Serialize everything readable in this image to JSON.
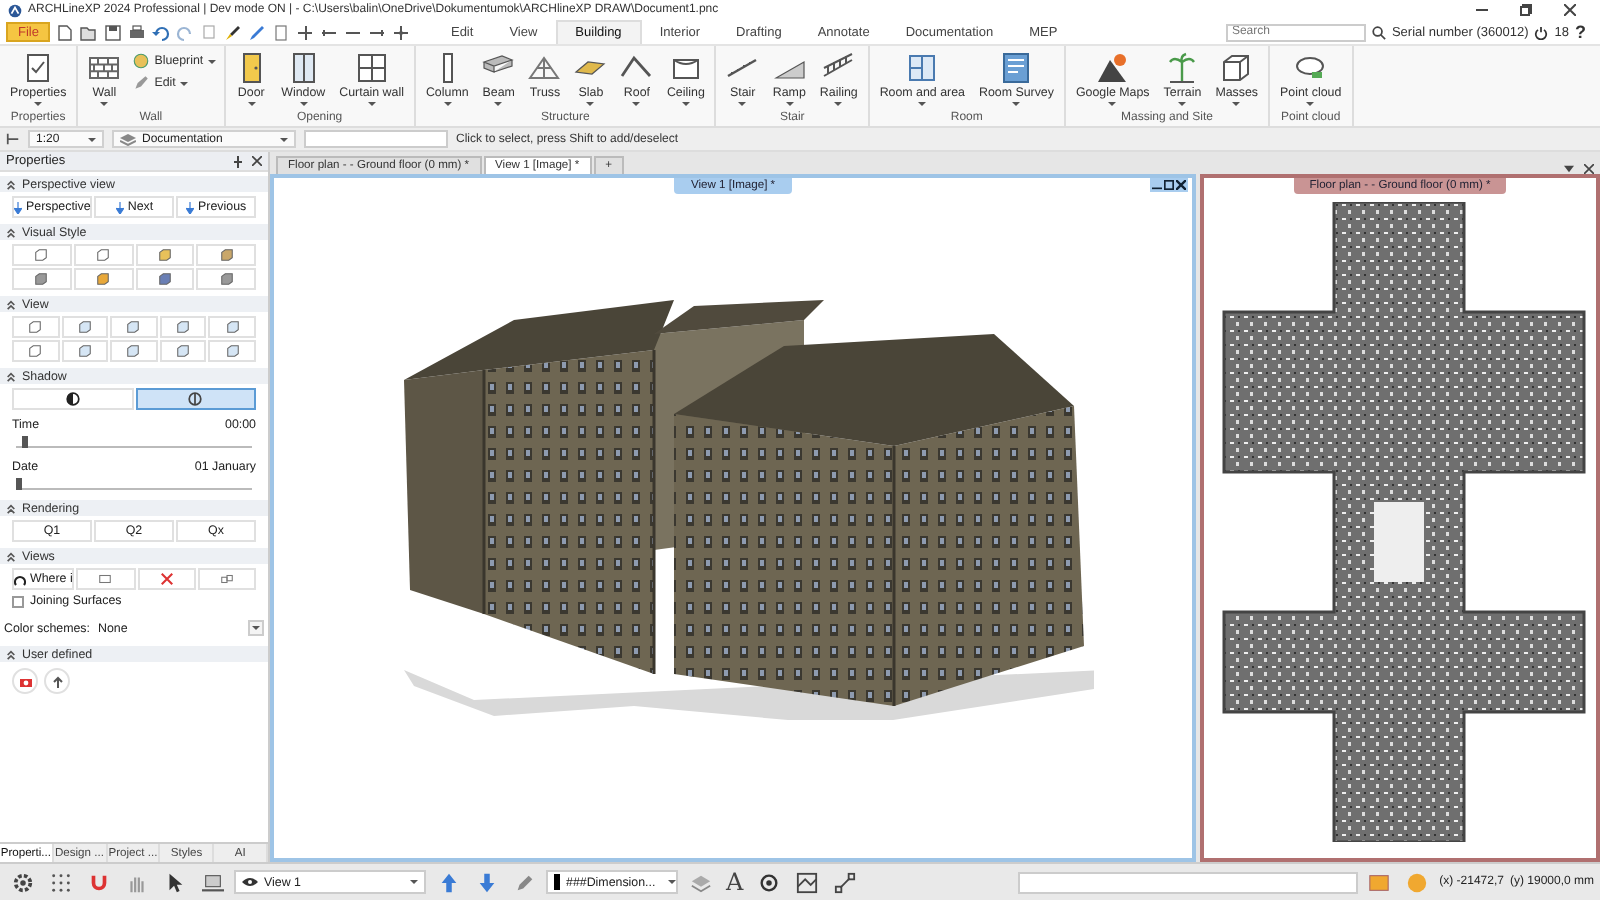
{
  "window": {
    "title": "ARCHLineXP 2024 Professional | Dev mode ON | - C:\\Users\\balin\\OneDrive\\Dokumentumok\\ARCHlineXP DRAW\\Document1.pnc"
  },
  "menu_bar": {
    "file_button": "File",
    "tabs": [
      {
        "label": "Edit",
        "selected": false
      },
      {
        "label": "View",
        "selected": false
      },
      {
        "label": "Building",
        "selected": true
      },
      {
        "label": "Interior",
        "selected": false
      },
      {
        "label": "Drafting",
        "selected": false
      },
      {
        "label": "Annotate",
        "selected": false
      },
      {
        "label": "Documentation",
        "selected": false
      },
      {
        "label": "MEP",
        "selected": false
      }
    ],
    "search": {
      "placeholder": "Search"
    },
    "serial_number": "Serial number (360012)",
    "counter": "18",
    "help": "?"
  },
  "ribbon": {
    "groups": [
      {
        "label": "Properties",
        "buttons": [
          {
            "label": "Properties",
            "kind": "large",
            "menu": true
          }
        ]
      },
      {
        "label": "Wall",
        "buttons": [
          {
            "label": "Wall",
            "kind": "large",
            "menu": true
          },
          {
            "label": "Blueprint",
            "kind": "small",
            "menu": true
          },
          {
            "label": "Edit",
            "kind": "small",
            "menu": true
          }
        ]
      },
      {
        "label": "Opening",
        "buttons": [
          {
            "label": "Door",
            "kind": "large",
            "menu": true
          },
          {
            "label": "Window",
            "kind": "large",
            "menu": true
          },
          {
            "label": "Curtain wall",
            "kind": "large",
            "menu": true
          }
        ]
      },
      {
        "label": "Structure",
        "buttons": [
          {
            "label": "Column",
            "kind": "large",
            "menu": true
          },
          {
            "label": "Beam",
            "kind": "large",
            "menu": true
          },
          {
            "label": "Truss",
            "kind": "large",
            "menu": false
          },
          {
            "label": "Slab",
            "kind": "large",
            "menu": true
          },
          {
            "label": "Roof",
            "kind": "large",
            "menu": true
          },
          {
            "label": "Ceiling",
            "kind": "large",
            "menu": true
          }
        ]
      },
      {
        "label": "Stair",
        "buttons": [
          {
            "label": "Stair",
            "kind": "large",
            "menu": true
          },
          {
            "label": "Ramp",
            "kind": "large",
            "menu": true
          },
          {
            "label": "Railing",
            "kind": "large",
            "menu": true
          }
        ]
      },
      {
        "label": "Room",
        "buttons": [
          {
            "label": "Room and area",
            "kind": "large",
            "menu": true
          },
          {
            "label": "Room Survey",
            "kind": "large",
            "menu": true
          }
        ]
      },
      {
        "label": "Massing and Site",
        "buttons": [
          {
            "label": "Google Maps",
            "kind": "large",
            "menu": true
          },
          {
            "label": "Terrain",
            "kind": "large",
            "menu": true
          },
          {
            "label": "Masses",
            "kind": "large",
            "menu": true
          }
        ]
      },
      {
        "label": "Point cloud",
        "buttons": [
          {
            "label": "Point cloud",
            "kind": "large",
            "menu": true
          }
        ]
      }
    ]
  },
  "option_bar": {
    "scale": "1:20",
    "layer": "Documentation",
    "hint": "Click to select, press Shift to add/deselect"
  },
  "properties_panel": {
    "title": "Properties",
    "sections": [
      {
        "kind": "buttons",
        "title": "Perspective view",
        "expanded": true,
        "buttons": [
          "Perspective",
          "Next",
          "Previous"
        ]
      },
      {
        "kind": "tiles",
        "title": "Visual Style",
        "expanded": true,
        "tiles": [
          {
            "selected": false
          },
          {
            "selected": false
          },
          {
            "selected": false
          },
          {
            "selected": false
          },
          {
            "selected": false
          },
          {
            "selected": false
          },
          {
            "selected": false
          },
          {
            "selected": false
          }
        ]
      },
      {
        "kind": "tiles",
        "title": "View",
        "expanded": true,
        "tiles": [
          {
            "selected": false
          },
          {
            "selected": false
          },
          {
            "selected": false
          },
          {
            "selected": false
          },
          {
            "selected": false
          },
          {
            "selected": false
          },
          {
            "selected": false
          },
          {
            "selected": false
          },
          {
            "selected": false
          },
          {
            "selected": false
          }
        ]
      },
      {
        "kind": "shadow",
        "title": "Shadow",
        "expanded": true,
        "tiles": [
          {
            "selected": false
          },
          {
            "selected": true
          }
        ],
        "sliders": [
          {
            "label": "Time",
            "reading": "00:00",
            "level": 0.03
          },
          {
            "label": "Date",
            "reading": "01 January",
            "level": 0.01
          }
        ]
      },
      {
        "kind": "buttons",
        "title": "Rendering",
        "expanded": true,
        "buttons": [
          "Q1",
          "Q2",
          "Qx"
        ]
      },
      {
        "kind": "views",
        "title": "Views",
        "expanded": true,
        "button": "Where i",
        "tiles": [
          {
            "selected": false
          },
          {
            "selected": false
          },
          {
            "selected": false
          }
        ],
        "checkbox": {
          "label": "Joining Surfaces",
          "checked": false
        }
      },
      {
        "kind": "setting",
        "label": "Color schemes:",
        "value": "None"
      },
      {
        "kind": "icons",
        "title": "User defined",
        "expanded": true,
        "tiles": [
          {
            "selected": false
          },
          {
            "selected": false
          }
        ]
      }
    ],
    "tabs": [
      {
        "label": "Properti...",
        "selected": true
      },
      {
        "label": "Design ...",
        "selected": false
      },
      {
        "label": "Project ...",
        "selected": false
      },
      {
        "label": "Styles",
        "selected": false
      },
      {
        "label": "AI",
        "selected": false
      }
    ]
  },
  "document_tabs": [
    {
      "label": "Floor plan - - Ground floor (0 mm) *",
      "selected": false
    },
    {
      "label": "View 1 [Image] *",
      "selected": true
    },
    {
      "label": "+",
      "selected": false
    }
  ],
  "views": [
    {
      "title": "View 1 [Image] *",
      "kind": "perspective",
      "active": true
    },
    {
      "title": "Floor plan - - Ground floor (0 mm) *",
      "kind": "plan",
      "active": false
    }
  ],
  "status_bar": {
    "view": "View 1",
    "dimension_style": "###Dimension...",
    "text_glyph": "A",
    "x": "(x) -21472,7",
    "y": "(y) 19000,0 mm"
  }
}
